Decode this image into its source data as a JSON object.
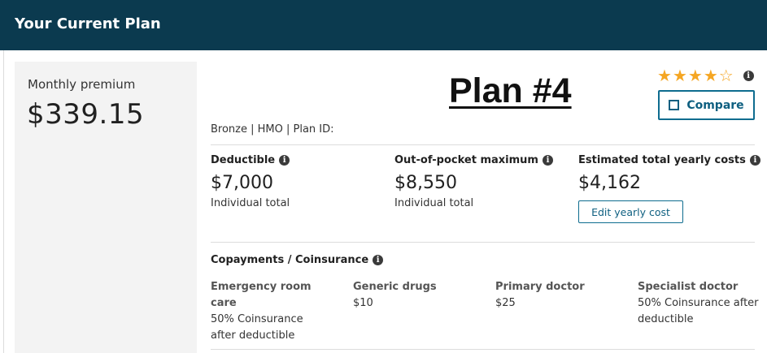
{
  "header": {
    "title": "Your Current Plan"
  },
  "premium": {
    "label": "Monthly premium",
    "value": "$339.15"
  },
  "plan": {
    "name": "Plan #4",
    "meta": "Bronze | HMO | Plan ID:",
    "rating": {
      "filled": 4,
      "max": 5
    },
    "compare_label": "Compare"
  },
  "costs": {
    "deductible": {
      "label": "Deductible",
      "value": "$7,000",
      "sub": "Individual total"
    },
    "oop_max": {
      "label": "Out-of-pocket maximum",
      "value": "$8,550",
      "sub": "Individual total"
    },
    "yearly": {
      "label": "Estimated total yearly costs",
      "value": "$4,162",
      "edit_label": "Edit yearly cost"
    }
  },
  "copay": {
    "heading": "Copayments / Coinsurance",
    "items": [
      {
        "title": "Emergency room care",
        "value": "50% Coinsurance after deductible"
      },
      {
        "title": "Generic drugs",
        "value": "$10"
      },
      {
        "title": "Primary doctor",
        "value": "$25"
      },
      {
        "title": "Specialist doctor",
        "value": "50% Coinsurance after deductible"
      }
    ]
  },
  "colors": {
    "header_bg": "#0b3a4f",
    "accent": "#0e6c8f",
    "star": "#f5a623"
  }
}
